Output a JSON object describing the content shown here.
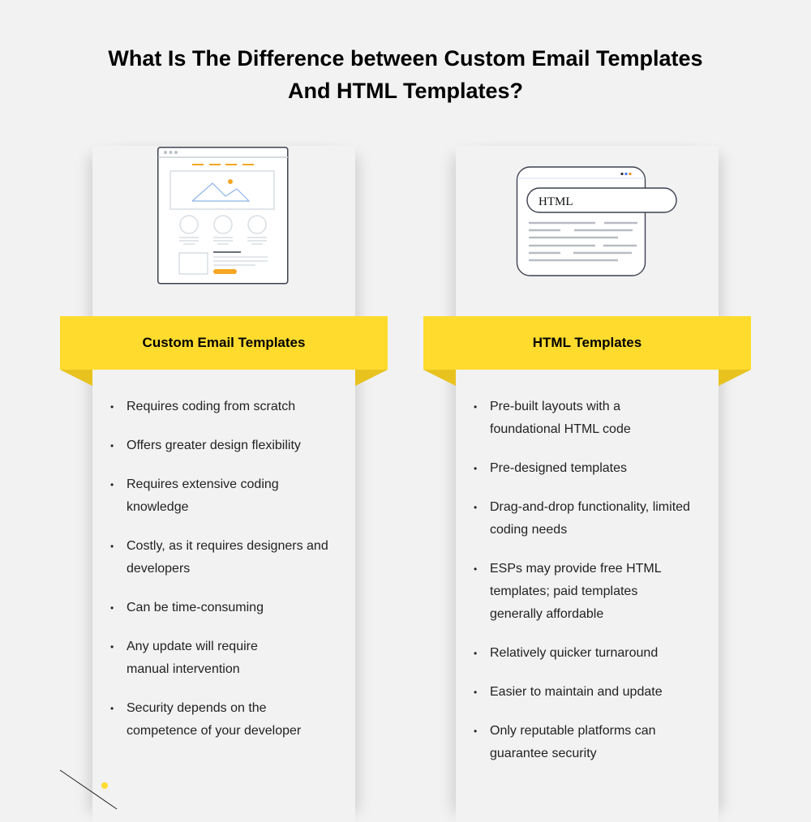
{
  "title": {
    "line1": "What Is The Difference between Custom Email Templates",
    "line2": "And HTML Templates?"
  },
  "left": {
    "heading": "Custom Email Templates",
    "illustration": "email-template-wireframe-icon",
    "items": [
      "Requires coding from scratch",
      "Offers greater design flexibility",
      "Requires extensive coding knowledge",
      "Costly, as it requires designers and developers",
      "Can be time-consuming",
      "Any update will require manual intervention",
      "Security depends on the competence of your developer"
    ]
  },
  "right": {
    "heading": "HTML Templates",
    "illustration": "html-browser-window-icon",
    "illustration_label": "HTML",
    "items": [
      "Pre-built layouts with a foundational HTML code",
      "Pre-designed templates",
      "Drag-and-drop functionality, limited coding needs",
      "ESPs may provide free HTML templates; paid templates generally affordable",
      "Relatively quicker turnaround",
      "Easier to maintain and update",
      "Only reputable platforms can guarantee security"
    ]
  },
  "bullet": "•",
  "colors": {
    "background": "#f2f2f2",
    "ribbon": "#ffdb2e",
    "ribbon_fold": "#e8c21e",
    "accent_orange": "#f5a623",
    "text": "#1f1f1f"
  }
}
